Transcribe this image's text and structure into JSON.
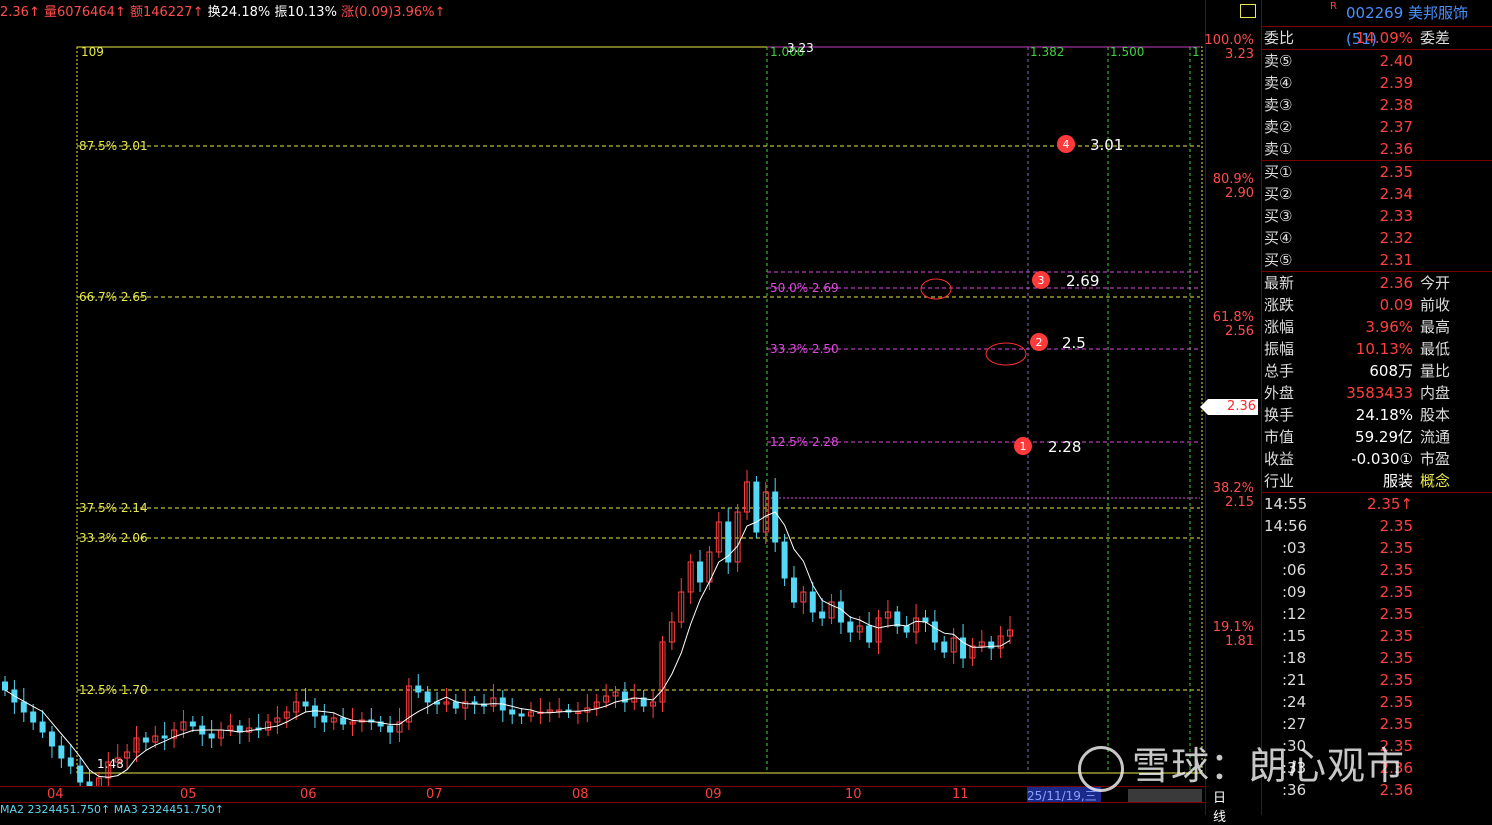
{
  "topbar": {
    "price": "2.36",
    "vol_label": "量6076464",
    "amt_label": "额146227",
    "turnover": "换24.18%",
    "amplitude": "振10.13%",
    "change": "涨(0.09)3.96%"
  },
  "chart": {
    "top_label": "109",
    "peak_label": "3.23",
    "low_label": "1.48",
    "fib_h": [
      {
        "pct": "87.5%",
        "val": "3.01"
      },
      {
        "pct": "66.7%",
        "val": "2.65"
      },
      {
        "pct": "37.5%",
        "val": "2.14"
      },
      {
        "pct": "33.3%",
        "val": "2.06"
      },
      {
        "pct": "12.5%",
        "val": "1.70"
      }
    ],
    "fib_m": [
      {
        "pct": "50.0%",
        "val": "2.69"
      },
      {
        "pct": "33.3%",
        "val": "2.50"
      },
      {
        "pct": "12.5%",
        "val": "2.28"
      }
    ],
    "time_labels": [
      "1.000",
      "1.382",
      "1.500",
      "1"
    ],
    "markers": [
      {
        "num": "4",
        "val": "3.01"
      },
      {
        "num": "3",
        "val": "2.69"
      },
      {
        "num": "2",
        "val": "2.5"
      },
      {
        "num": "1",
        "val": "2.28"
      }
    ]
  },
  "pct_axis": [
    {
      "pct": "100.0%",
      "price": "3.23"
    },
    {
      "pct": "80.9%",
      "price": "2.90"
    },
    {
      "pct": "61.8%",
      "price": "2.56"
    },
    {
      "pct": "38.2%",
      "price": "2.15"
    },
    {
      "pct": "19.1%",
      "price": "1.81"
    }
  ],
  "current_price_tag": "2.36",
  "right": {
    "stock": "002269 美邦服饰(51)",
    "badge": "R",
    "weibi": {
      "l": "委比",
      "v": "14.09%",
      "r": "委差"
    },
    "sell": [
      {
        "l": "卖⑤",
        "v": "2.40"
      },
      {
        "l": "卖④",
        "v": "2.39"
      },
      {
        "l": "卖③",
        "v": "2.38"
      },
      {
        "l": "卖②",
        "v": "2.37"
      },
      {
        "l": "卖①",
        "v": "2.36"
      }
    ],
    "buy": [
      {
        "l": "买①",
        "v": "2.35"
      },
      {
        "l": "买②",
        "v": "2.34"
      },
      {
        "l": "买③",
        "v": "2.33"
      },
      {
        "l": "买④",
        "v": "2.32"
      },
      {
        "l": "买⑤",
        "v": "2.31"
      }
    ],
    "stats": [
      {
        "l": "最新",
        "v": "2.36",
        "r": "今开"
      },
      {
        "l": "涨跌",
        "v": "0.09",
        "r": "前收"
      },
      {
        "l": "涨幅",
        "v": "3.96%",
        "r": "最高"
      },
      {
        "l": "振幅",
        "v": "10.13%",
        "r": "最低"
      },
      {
        "l": "总手",
        "v": "608万",
        "r": "量比"
      },
      {
        "l": "外盘",
        "v": "3583433",
        "r": "内盘"
      },
      {
        "l": "换手",
        "v": "24.18%",
        "r": "股本"
      },
      {
        "l": "市值",
        "v": "59.29亿",
        "r": "流通"
      },
      {
        "l": "收益",
        "v": "-0.030①",
        "r": "市盈"
      },
      {
        "l": "行业",
        "v": "服装",
        "r": "概念"
      }
    ],
    "ticks": [
      {
        "t": "14:55",
        "p": "2.35↑"
      },
      {
        "t": "14:56",
        "p": "2.35"
      },
      {
        "t": ":03",
        "p": "2.35"
      },
      {
        "t": ":06",
        "p": "2.35"
      },
      {
        "t": ":09",
        "p": "2.35"
      },
      {
        "t": ":12",
        "p": "2.35"
      },
      {
        "t": ":15",
        "p": "2.35"
      },
      {
        "t": ":18",
        "p": "2.35"
      },
      {
        "t": ":21",
        "p": "2.35"
      },
      {
        "t": ":24",
        "p": "2.35"
      },
      {
        "t": ":27",
        "p": "2.35"
      },
      {
        "t": ":30",
        "p": "2.35"
      },
      {
        "t": ":33",
        "p": "2.36"
      },
      {
        "t": ":36",
        "p": "2.36"
      }
    ]
  },
  "xaxis": {
    "months": [
      "04",
      "05",
      "06",
      "07",
      "08",
      "09",
      "10",
      "11"
    ],
    "date": "25/11/19,三",
    "period": "日线"
  },
  "mabar": "MA2 2324451.750↑   MA3 2324451.750↑",
  "watermark": "雪球：朗心观市"
}
